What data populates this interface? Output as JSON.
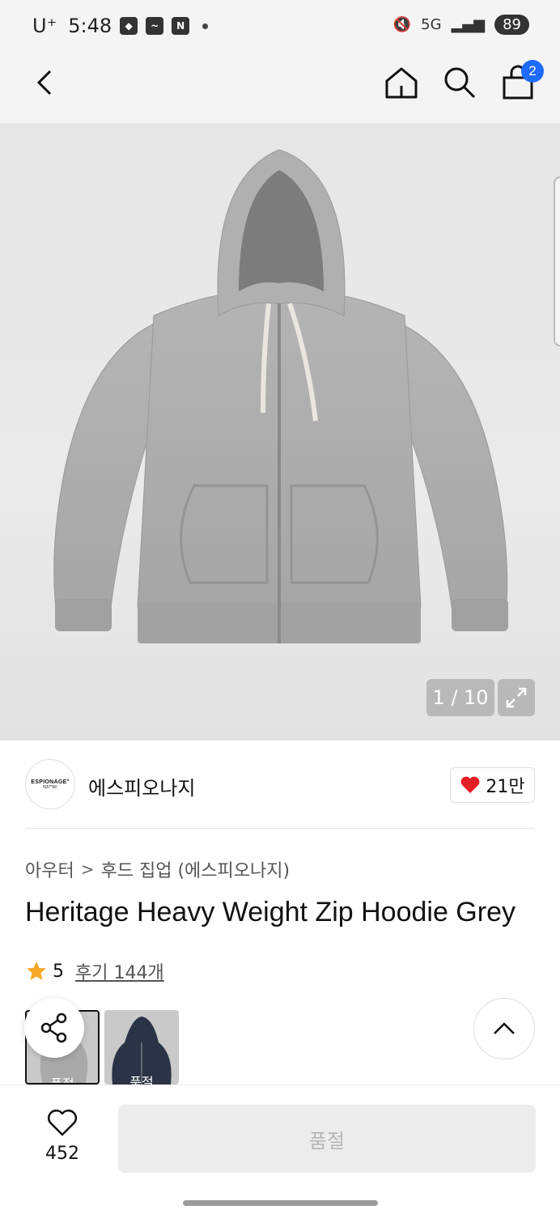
{
  "status_bar": {
    "carrier": "U⁺",
    "time": "5:48",
    "network": "5G",
    "battery": "89"
  },
  "header": {
    "cart_count": "2"
  },
  "gallery": {
    "counter": "1 / 10"
  },
  "brand": {
    "logo_line1": "ESPIONAGE°",
    "logo_line2": "N37°56'",
    "name": "에스피오나지",
    "likes": "21만"
  },
  "breadcrumb": {
    "category": "아우터",
    "separator": ">",
    "subcategory": "후드 집업 (에스피오나지)"
  },
  "product": {
    "title": "Heritage Heavy Weight Zip Hoodie Grey",
    "rating": "5",
    "reviews": "후기 144개"
  },
  "options": [
    {
      "label": "품절",
      "color": "#a9a9a9"
    },
    {
      "label": "품절",
      "color": "#2b3446"
    }
  ],
  "bottom": {
    "wish_count": "452",
    "buy_label": "품절"
  },
  "colors": {
    "cart_badge": "#1e6bff",
    "heart": "#e41e26",
    "star": "#f5a623"
  }
}
